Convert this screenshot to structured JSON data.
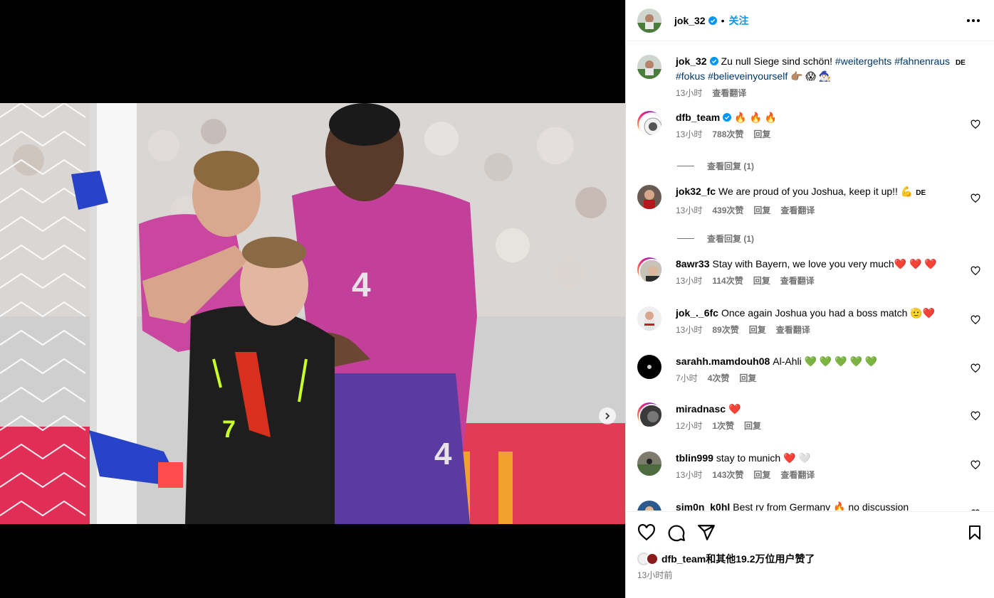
{
  "post": {
    "author": "jok_32",
    "follow_label": "关注",
    "bullet": "•",
    "caption_text": "Zu null Siege sind schön!",
    "hashtags_line1": [
      "#weitergehts",
      "#fahnenraus"
    ],
    "hashtags_line2": [
      "#fokus",
      "#believeinyourself"
    ],
    "caption_emoji": "👉🏽 😱 🧙🏻‍♂️",
    "lang_badge": "DE",
    "caption_time": "13小时",
    "caption_translate": "查看翻译"
  },
  "media": {
    "carousel_count": 3,
    "active_index": 0
  },
  "comments": [
    {
      "user": "dfb_team",
      "verified": true,
      "text": "🔥 🔥 🔥",
      "time": "13小时",
      "likes": "788次赞",
      "reply": "回复",
      "translate": "",
      "replies": "查看回复 (1)",
      "lang": ""
    },
    {
      "user": "jok32_fc",
      "verified": false,
      "text": "We are proud of you Joshua, keep it up!! 💪",
      "time": "13小时",
      "likes": "439次赞",
      "reply": "回复",
      "translate": "查看翻译",
      "replies": "查看回复 (1)",
      "lang": "DE"
    },
    {
      "user": "8awr33",
      "verified": false,
      "text": "Stay with Bayern, we love you very much❤️ ❤️ ❤️",
      "time": "13小时",
      "likes": "114次赞",
      "reply": "回复",
      "translate": "查看翻译",
      "replies": "",
      "lang": ""
    },
    {
      "user": "jok_._6fc",
      "verified": false,
      "text": "Once again Joshua you had a boss match 🫡❤️",
      "time": "13小时",
      "likes": "89次赞",
      "reply": "回复",
      "translate": "查看翻译",
      "replies": "",
      "lang": ""
    },
    {
      "user": "sarahh.mamdouh08",
      "verified": false,
      "text": "Al-Ahli 💚 💚 💚 💚 💚",
      "time": "7小时",
      "likes": "4次赞",
      "reply": "回复",
      "translate": "",
      "replies": "",
      "lang": ""
    },
    {
      "user": "miradnasc",
      "verified": false,
      "text": "❤️",
      "time": "12小时",
      "likes": "1次赞",
      "reply": "回复",
      "translate": "",
      "replies": "",
      "lang": ""
    },
    {
      "user": "tblin999",
      "verified": false,
      "text": "stay to munich ❤️ 🤍",
      "time": "13小时",
      "likes": "143次赞",
      "reply": "回复",
      "translate": "查看翻译",
      "replies": "",
      "lang": ""
    },
    {
      "user": "sim0n_k0hl",
      "verified": false,
      "text": "Best rv from Germany 🔥 no discussion",
      "time": "",
      "likes": "",
      "reply": "",
      "translate": "",
      "replies": "",
      "lang": ""
    }
  ],
  "likes_summary": {
    "text": "dfb_team和其他19.2万位用户赞了"
  },
  "post_time": "13小时前",
  "colors": {
    "accent": "#0095f6",
    "verified": "#0095f6",
    "secondary_text": "#737373",
    "hashtag": "#00376b"
  },
  "icons": [
    "verified-badge-icon",
    "more-options-icon",
    "heart-icon",
    "comment-icon",
    "share-icon",
    "bookmark-icon",
    "next-arrow-icon"
  ]
}
